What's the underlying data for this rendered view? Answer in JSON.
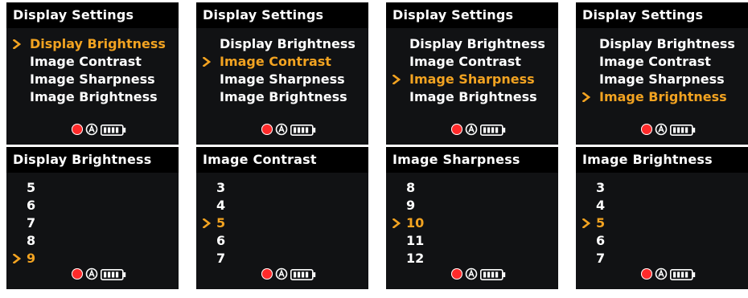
{
  "colors": {
    "selected": "#f2a321",
    "normal": "#ffffff",
    "panel_bg": "#111214",
    "title_bg": "#000000",
    "rec": "#ff2a2a"
  },
  "icons": {
    "selection": "chevron-right-icon",
    "status": [
      "record-icon",
      "auto-icon",
      "battery-icon"
    ]
  },
  "panels": [
    {
      "title": "Display Settings",
      "items": [
        {
          "label": "Display Brightness",
          "selected": true
        },
        {
          "label": "Image Contrast",
          "selected": false
        },
        {
          "label": "Image Sharpness",
          "selected": false
        },
        {
          "label": "Image Brightness",
          "selected": false
        }
      ]
    },
    {
      "title": "Display Settings",
      "items": [
        {
          "label": "Display Brightness",
          "selected": false
        },
        {
          "label": "Image Contrast",
          "selected": true
        },
        {
          "label": "Image Sharpness",
          "selected": false
        },
        {
          "label": "Image Brightness",
          "selected": false
        }
      ]
    },
    {
      "title": "Display Settings",
      "items": [
        {
          "label": "Display Brightness",
          "selected": false
        },
        {
          "label": "Image Contrast",
          "selected": false
        },
        {
          "label": "Image Sharpness",
          "selected": true
        },
        {
          "label": "Image Brightness",
          "selected": false
        }
      ]
    },
    {
      "title": "Display Settings",
      "items": [
        {
          "label": "Display Brightness",
          "selected": false
        },
        {
          "label": "Image Contrast",
          "selected": false
        },
        {
          "label": "Image Sharpness",
          "selected": false
        },
        {
          "label": "Image Brightness",
          "selected": true
        }
      ]
    },
    {
      "title": "Display Brightness",
      "items": [
        {
          "label": "5",
          "selected": false
        },
        {
          "label": "6",
          "selected": false
        },
        {
          "label": "7",
          "selected": false
        },
        {
          "label": "8",
          "selected": false
        },
        {
          "label": "9",
          "selected": true
        }
      ]
    },
    {
      "title": "Image Contrast",
      "items": [
        {
          "label": "3",
          "selected": false
        },
        {
          "label": "4",
          "selected": false
        },
        {
          "label": "5",
          "selected": true
        },
        {
          "label": "6",
          "selected": false
        },
        {
          "label": "7",
          "selected": false
        }
      ]
    },
    {
      "title": "Image Sharpness",
      "items": [
        {
          "label": "8",
          "selected": false
        },
        {
          "label": "9",
          "selected": false
        },
        {
          "label": "10",
          "selected": true
        },
        {
          "label": "11",
          "selected": false
        },
        {
          "label": "12",
          "selected": false
        }
      ]
    },
    {
      "title": "Image Brightness",
      "items": [
        {
          "label": "3",
          "selected": false
        },
        {
          "label": "4",
          "selected": false
        },
        {
          "label": "5",
          "selected": true
        },
        {
          "label": "6",
          "selected": false
        },
        {
          "label": "7",
          "selected": false
        }
      ]
    }
  ]
}
